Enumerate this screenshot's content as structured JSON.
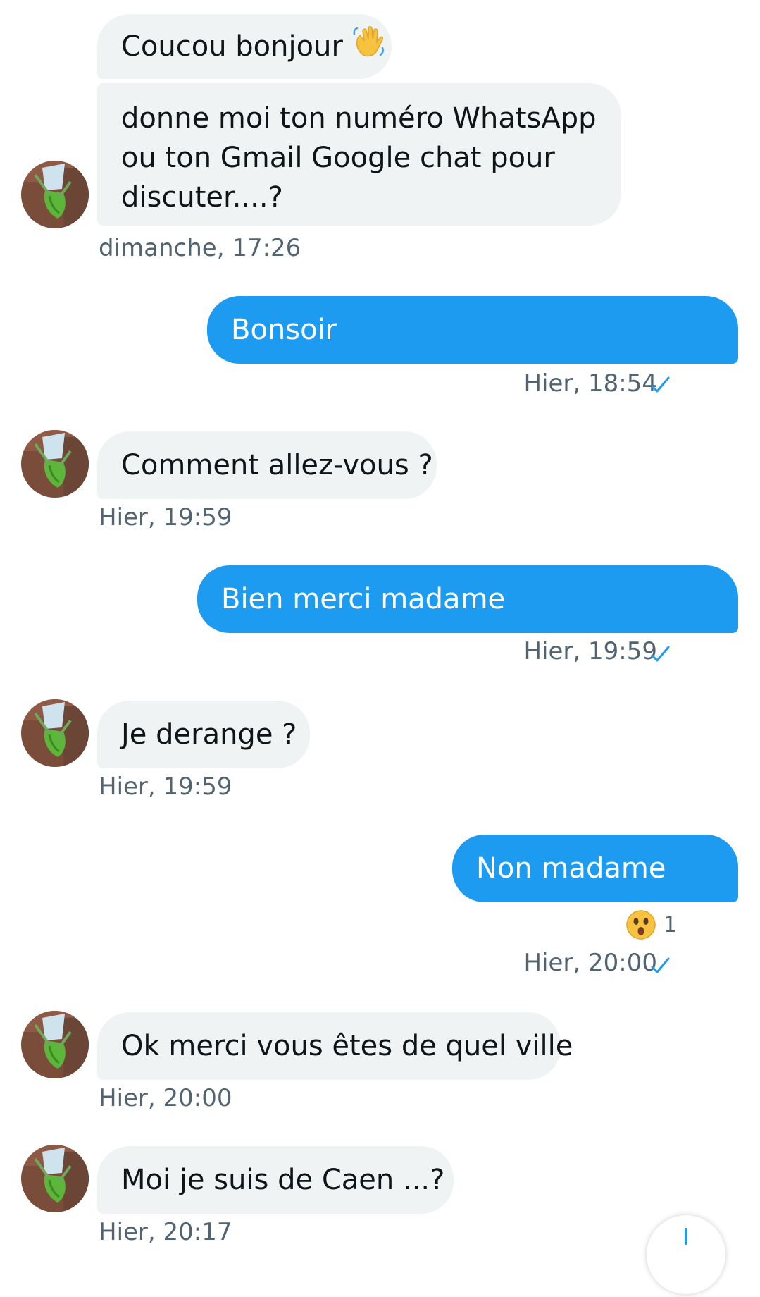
{
  "colors": {
    "accent": "#1d9bf0",
    "incoming_bubble": "#eff3f4",
    "text": "#0f1419",
    "timestamp": "#536471"
  },
  "avatar_icon": "orchid-flower-avatar",
  "messages": [
    {
      "text": "Coucou bonjour",
      "emoji": "waving-hand-emoji"
    },
    {
      "text": "donne moi ton numéro WhatsApp ou ton Gmail Google chat pour discuter....?"
    },
    {
      "timestamp": "dimanche, 17:26"
    },
    {
      "text": "Bonsoir",
      "timestamp": "Hier, 18:54",
      "status_icon": "sent-check-icon"
    },
    {
      "text": "Comment allez-vous ?",
      "timestamp": "Hier, 19:59"
    },
    {
      "text": "Bien merci madame",
      "timestamp": "Hier, 19:59",
      "status_icon": "sent-check-icon"
    },
    {
      "text": "Je derange ?",
      "timestamp": "Hier, 19:59"
    },
    {
      "text": "Non madame",
      "timestamp": "Hier, 20:00",
      "status_icon": "sent-check-icon",
      "reaction": {
        "emoji": "astonished-face-emoji",
        "count": "1"
      }
    },
    {
      "text": "Ok merci vous êtes de quel ville",
      "timestamp": "Hier, 20:00"
    },
    {
      "text": "Moi je suis de Caen ...?",
      "timestamp": "Hier, 20:17"
    }
  ]
}
